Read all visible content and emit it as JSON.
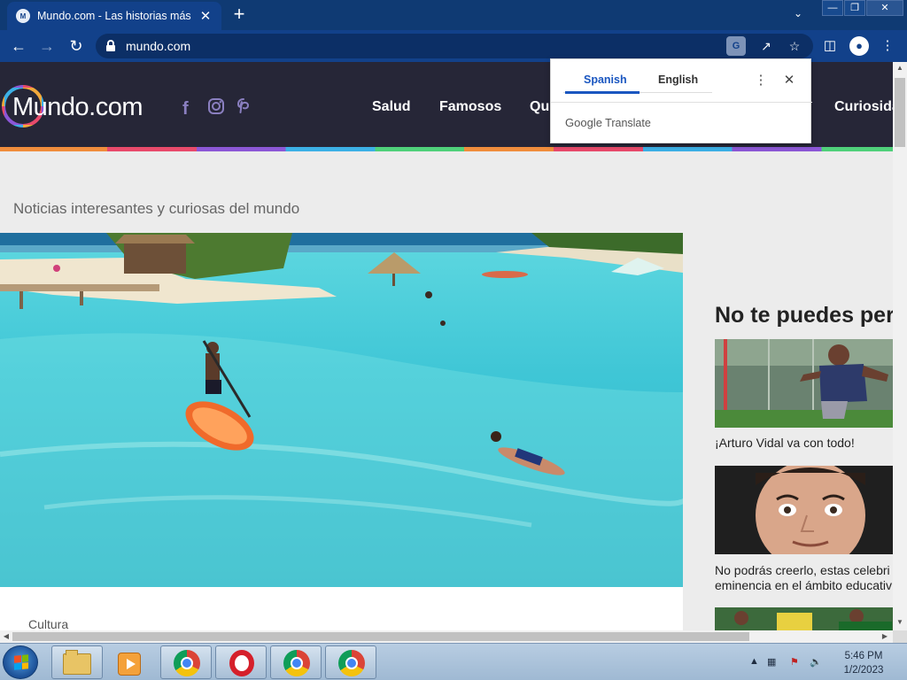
{
  "browser": {
    "tab_title": "Mundo.com - Las historias más e",
    "tab_favicon": "M",
    "tab_close": "✕",
    "new_tab": "+",
    "url": "mundo.com"
  },
  "site": {
    "logo_text": "Mundo.com",
    "nav": [
      "Salud",
      "Famosos",
      "Qui",
      "Curiosida"
    ],
    "tagline": "Noticias interesantes y curiosas del mundo",
    "category": "Cultura",
    "sidebar_title": "No te puedes per",
    "sidebar_items": [
      {
        "caption": "¡Arturo Vidal va con todo!"
      },
      {
        "caption": "No podrás creerlo, estas celebri",
        "caption2": "eminencia en el ámbito educativ"
      }
    ]
  },
  "translate_popup": {
    "lang_source": "Spanish",
    "lang_target": "English",
    "brand_google": "Google",
    "brand_translate": "Translate"
  },
  "taskbar": {
    "time": "5:46 PM",
    "date": "1/2/2023"
  },
  "colors": {
    "chrome_frame": "#0f3a73",
    "chrome_toolbar": "#12418a",
    "site_header": "#262637",
    "translate_active": "#1a56c0"
  }
}
